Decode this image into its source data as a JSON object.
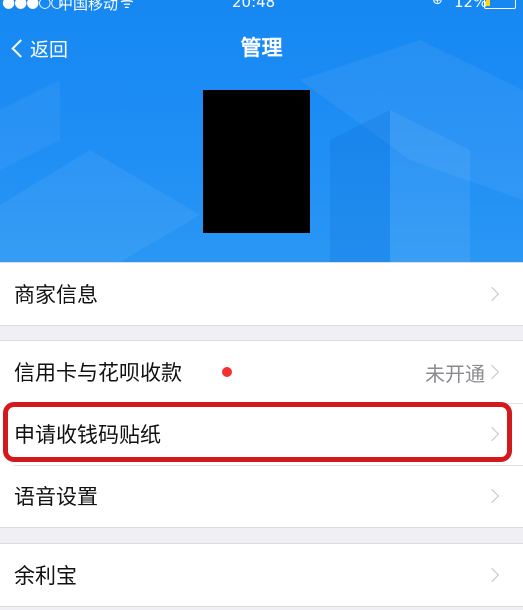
{
  "status_bar": {
    "signal": "●●●○○",
    "carrier": "中国移动",
    "wifi": "ᯤ",
    "time": "20:48",
    "battery_percent": "12%",
    "lock": "⊕"
  },
  "nav": {
    "back_label": "返回",
    "title": "管理"
  },
  "menu": {
    "group1": [
      {
        "label": "商家信息"
      }
    ],
    "group2": [
      {
        "label": "信用卡与花呗收款",
        "status": "未开通",
        "has_red_dot": true
      },
      {
        "label": "申请收钱码贴纸",
        "highlighted": true
      },
      {
        "label": "语音设置"
      }
    ],
    "group3": [
      {
        "label": "余利宝"
      }
    ]
  },
  "colors": {
    "header_blue": "#1f8ef5",
    "background": "#efeff4",
    "highlight_red": "#d3191b",
    "red_dot": "#f5312f"
  }
}
